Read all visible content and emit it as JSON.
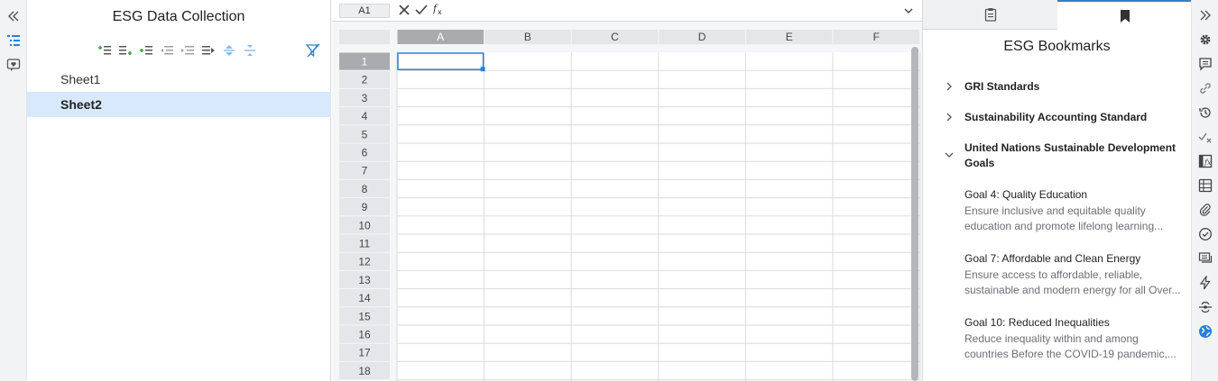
{
  "left_panel": {
    "title": "ESG Data Collection",
    "sheets": [
      {
        "label": "Sheet1",
        "active": false
      },
      {
        "label": "Sheet2",
        "active": true
      }
    ],
    "toolbar_icons": [
      "insert-row-above-icon",
      "insert-row-below-icon",
      "insert-column-icon",
      "outdent-icon",
      "indent-icon",
      "move-right-icon",
      "expand-icon",
      "collapse-icon"
    ]
  },
  "spreadsheet": {
    "name_box": "A1",
    "columns": [
      "A",
      "B",
      "C",
      "D",
      "E",
      "F"
    ],
    "rows": [
      "1",
      "2",
      "3",
      "4",
      "5",
      "6",
      "7",
      "8",
      "9",
      "10",
      "11",
      "12",
      "13",
      "14",
      "15",
      "16",
      "17",
      "18"
    ],
    "selected_cell": "A1"
  },
  "right_panel": {
    "title": "ESG Bookmarks",
    "tabs": [
      "clipboard-icon",
      "bookmark-icon"
    ],
    "sections": [
      {
        "label": "GRI Standards",
        "expanded": false
      },
      {
        "label": "Sustainability Accounting Standard",
        "expanded": false
      },
      {
        "label": "United Nations Sustainable Development Goals",
        "expanded": true
      }
    ],
    "goals": [
      {
        "title": "Goal 4: Quality Education",
        "desc1": "Ensure inclusive and equitable quality",
        "desc2": "education and promote lifelong learning..."
      },
      {
        "title": "Goal 7: Affordable and Clean Energy",
        "desc1": "Ensure access to affordable, reliable,",
        "desc2": "sustainable and modern energy for all Over..."
      },
      {
        "title": "Goal 10: Reduced Inequalities",
        "desc1": "Reduce inequality within and among",
        "desc2": "countries Before the COVID-19 pandemic,..."
      }
    ]
  },
  "colors": {
    "accent": "#2b7fd6",
    "selected_row": "#d7e9fb",
    "header_selected": "#a9abae"
  }
}
